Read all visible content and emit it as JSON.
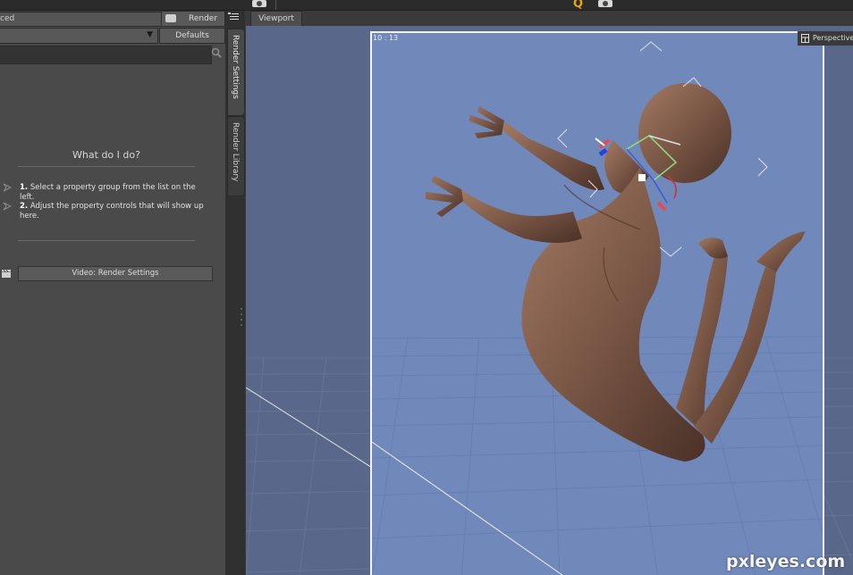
{
  "toolbar": {
    "tab_fragment": "ced",
    "render_label": "Render",
    "defaults_label": "Defaults",
    "dropdown_value": ""
  },
  "search": {
    "placeholder": ""
  },
  "help": {
    "title": "What do I do?",
    "step1_num": "1.",
    "step1_text": "Select a property group from the list on the left.",
    "step2_num": "2.",
    "step2_text": "Adjust the property controls that will show up here.",
    "video_button": "Video: Render Settings"
  },
  "side_tabs": {
    "render_settings": "Render Settings",
    "render_library": "Render Library"
  },
  "viewport": {
    "tab_label": "Viewport",
    "aspect_readout": "10 : 13",
    "camera_label": "Perspective"
  },
  "watermark": "pxleyes.com",
  "colors": {
    "panel_bg": "#4a4a4a",
    "viewport_bg": "#59688a",
    "frame_bg": "#7088ba",
    "accent_gold": "#e5a41d"
  },
  "icons": [
    "camera-icon",
    "gold-render-icon",
    "search-icon",
    "arrow-icon",
    "clapboard-icon",
    "panel-menu-icon",
    "perspective-icon"
  ]
}
